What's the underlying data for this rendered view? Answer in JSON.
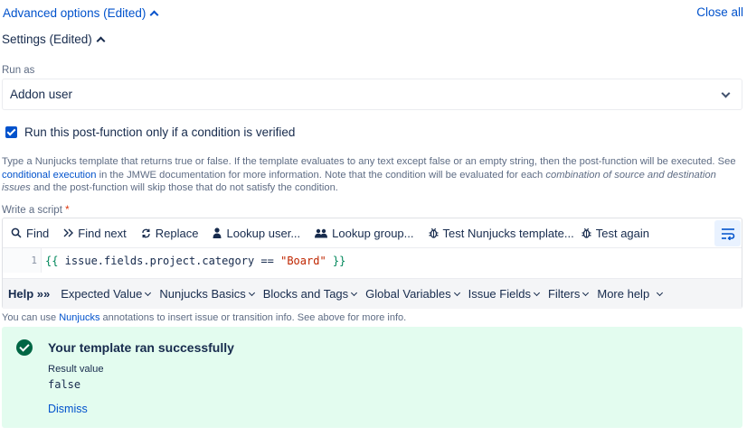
{
  "advanced": {
    "label": "Advanced options (Edited)",
    "close_all": "Close all"
  },
  "settings": {
    "label": "Settings (Edited)"
  },
  "run_as": {
    "label": "Run as",
    "value": "Addon user"
  },
  "condition": {
    "label": "Run this post-function only if a condition is verified",
    "checked": true
  },
  "description": {
    "part1": "Type a Nunjucks template that returns true or false. If the template evaluates to any text except false or an empty string, then the post-function will be executed. See ",
    "link": "conditional execution",
    "part2": " in the JMWE documentation for more information. Note that the condition will be evaluated for each ",
    "italic": "combination of source and destination issues",
    "part3": " and the post-function will skip those that do not satisfy the condition."
  },
  "script": {
    "label": "Write a script",
    "required_mark": "*",
    "toolbar": {
      "find": "Find",
      "find_next": "Find next",
      "replace": "Replace",
      "lookup_user": "Lookup user...",
      "lookup_group": "Lookup group...",
      "test_template": "Test Nunjucks template...",
      "test_again": "Test again"
    },
    "line_number": "1",
    "code": {
      "open": "{{",
      "expr": " issue.fields.project.category == ",
      "string": "\"Board\"",
      "close": " }}"
    },
    "help": {
      "title": "Help »»",
      "items": [
        "Expected Value",
        "Nunjucks Basics",
        "Blocks and Tags",
        "Global Variables",
        "Issue Fields",
        "Filters",
        "More help"
      ]
    }
  },
  "hint": {
    "part1": "You can use ",
    "link": "Nunjucks",
    "part2": " annotations to insert issue or transition info. See above for more info."
  },
  "result": {
    "title": "Your template ran successfully",
    "label": "Result value",
    "value": "false",
    "dismiss": "Dismiss"
  },
  "colors": {
    "accent": "#0052cc",
    "success_bg": "#e3fcef",
    "success_icon": "#006644"
  }
}
